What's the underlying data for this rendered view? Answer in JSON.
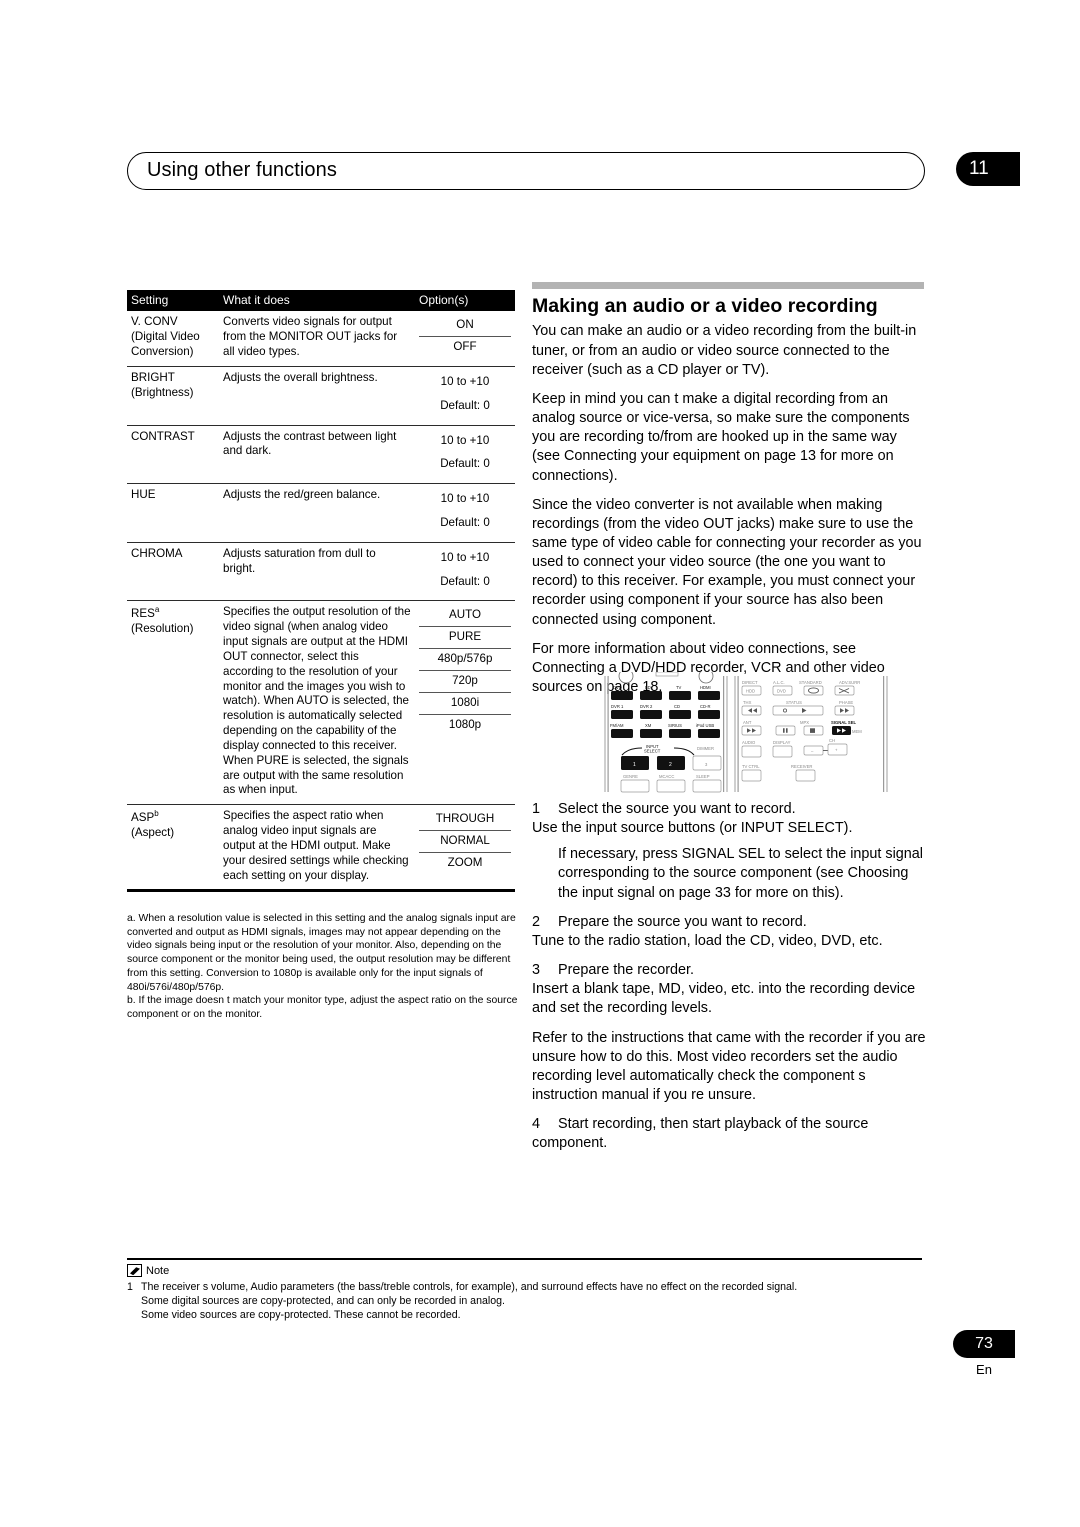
{
  "header": {
    "title": "Using other functions",
    "chapter_badge": "11"
  },
  "table": {
    "columns": [
      "Setting",
      "What it does",
      "Option(s)"
    ],
    "rows": [
      {
        "setting": "V. CONV",
        "setting_sub": "(Digital Video Conversion)",
        "what": "Converts video signals for output from the MONITOR OUT jacks for all video types.",
        "options": [
          "ON",
          "OFF"
        ]
      },
      {
        "setting": "BRIGHT",
        "setting_sub": "(Brightness)",
        "what": "Adjusts the overall brightness.",
        "options": [
          "10 to +10",
          "Default: 0"
        ],
        "options_style": "block"
      },
      {
        "setting": "CONTRAST",
        "setting_sub": "",
        "what": "Adjusts the contrast between light and dark.",
        "options": [
          "10 to +10",
          "Default: 0"
        ],
        "options_style": "block"
      },
      {
        "setting": "HUE",
        "setting_sub": "",
        "what": "Adjusts the red/green balance.",
        "options": [
          "10 to +10",
          "Default: 0"
        ],
        "options_style": "block"
      },
      {
        "setting": "CHROMA",
        "setting_sub": "",
        "what": "Adjusts saturation from dull to bright.",
        "options": [
          "10 to +10",
          "Default: 0"
        ],
        "options_style": "block"
      },
      {
        "setting": "RES",
        "setting_note": "a",
        "setting_sub": "(Resolution)",
        "what": "Specifies the output resolution of the video signal (when analog video input signals are output at the HDMI OUT connector, select this according to the resolution of your monitor and the images you wish to watch). When AUTO is selected, the resolution is automatically selected depending on the capability of the display connected to this receiver. When PURE is selected, the signals are output with the same resolution as when input.",
        "options": [
          "AUTO",
          "PURE",
          "480p/576p",
          "720p",
          "1080i",
          "1080p"
        ]
      },
      {
        "setting": "ASP",
        "setting_note": "b",
        "setting_sub": "(Aspect)",
        "what": "Specifies the aspect ratio when analog video input signals are output at the HDMI output. Make your desired settings while checking each setting on your display.",
        "options": [
          "THROUGH",
          "NORMAL",
          "ZOOM"
        ]
      }
    ]
  },
  "footnotes": [
    "a. When a resolution value is selected in this setting and the analog signals input are converted and output as HDMI signals, images may not appear depending on the video signals being input or the resolution of your monitor. Also, depending on the source component or the monitor being used, the output resolution may be different from this setting. Conversion to 1080p is available only for the input signals of 480i/576i/480p/576p.",
    "b. If the image doesn t match your monitor type, adjust the aspect ratio on the source component or on the monitor."
  ],
  "section": {
    "title": "Making an audio or a video recording",
    "paragraphs": [
      "You can make an audio or a video recording from the built-in tuner, or from an audio or video source connected to the receiver (such as a CD player or TV).",
      "Keep in mind you can t make a digital recording from an analog source or vice-versa, so make sure the components you are recording to/from are hooked up in the same way (see Connecting your equipment on page 13 for more on connections).",
      "Since the video converter is not available when making recordings (from the video OUT jacks) make sure to use the same type of video cable for connecting your recorder as you used to connect your video source (the one you want to record) to this receiver. For example, you must connect your recorder using component if your source has also been connected using component.",
      "For more information about video connections, see Connecting a DVD/HDD recorder, VCR and other video sources on page 18."
    ]
  },
  "remote": {
    "left_buttons": [
      [
        "DVD",
        "BD",
        "TV",
        "HDMI"
      ],
      [
        "DVR 1",
        "DVR 2",
        "CD",
        "CD-R"
      ],
      [
        "FM/AM",
        "XM",
        "SIRIUS",
        "iPod USB"
      ]
    ],
    "input_select_label": "INPUT SELECT",
    "dimmer_label": "DIMMER",
    "numeric_buttons": [
      "1",
      "2",
      "3"
    ],
    "bottom_labels": [
      "GENRE",
      "MCACC",
      "SLEEP"
    ],
    "right_labels": {
      "row1": [
        "DIRECT",
        "A.L.C.",
        "STANDARD",
        "ADV.SURR"
      ],
      "row1_btns": [
        "HDD",
        "DVD",
        "",
        ""
      ],
      "row2": [
        "THX",
        "STATUS",
        "PHASE"
      ],
      "row3": [
        "ANT",
        "MPX",
        "SIGNAL SEL"
      ],
      "row4": [
        "AUDIO",
        "DISPLAY",
        "CH"
      ],
      "row5": [
        "TV CTRL",
        "RECEIVER"
      ],
      "ch_minus": "–",
      "ch_plus": "+"
    }
  },
  "steps": [
    {
      "num": "1",
      "title": "Select the source you want to record.",
      "body": "Use the input source buttons (or INPUT SELECT).",
      "indent": "If necessary, press SIGNAL SEL to select the input signal corresponding to the source component (see Choosing the input signal on page 33 for more on this)."
    },
    {
      "num": "2",
      "title": "Prepare the source you want to record.",
      "body": "Tune to the radio station, load the CD, video, DVD, etc.",
      "indent": ""
    },
    {
      "num": "3",
      "title": "Prepare the recorder.",
      "body": "Insert a blank tape, MD, video, etc. into the recording device and set the recording levels.",
      "extra": "Refer to the instructions that came with the recorder if you are unsure how to do this. Most video recorders set the audio recording level automatically check the component s instruction manual if you re unsure."
    },
    {
      "num": "4",
      "title": "Start recording, then start playback of the source component.",
      "body": "",
      "indent": ""
    }
  ],
  "note": {
    "label": "Note",
    "items": [
      {
        "num": "1",
        "lines": [
          "The receiver s volume, Audio parameters (the bass/treble controls, for example), and surround effects have no effect on the recorded signal.",
          "Some digital sources are copy-protected, and can only be recorded in analog.",
          "Some video sources are copy-protected. These cannot be recorded."
        ]
      }
    ]
  },
  "footer": {
    "page_number": "73",
    "language": "En"
  }
}
